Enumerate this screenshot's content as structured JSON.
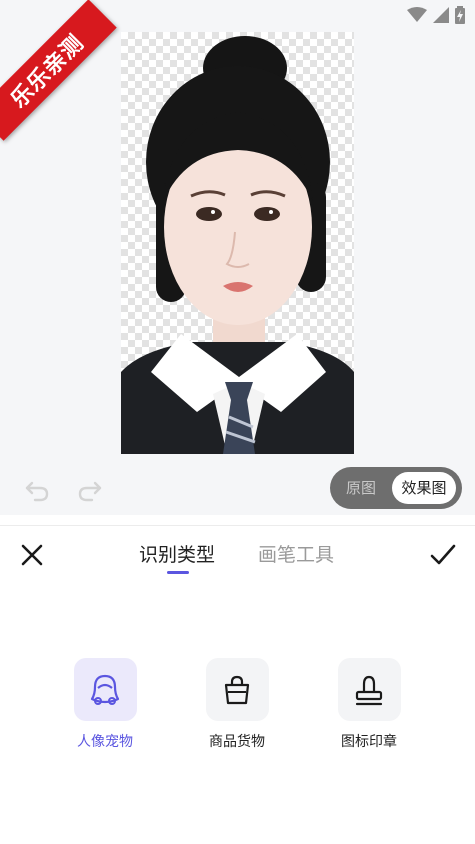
{
  "watermark": "乐乐亲测",
  "toggle": {
    "original": "原图",
    "effect": "效果图",
    "selected": "效果图"
  },
  "tabs": [
    {
      "label": "识别类型",
      "active": true
    },
    {
      "label": "画笔工具",
      "active": false
    }
  ],
  "options": [
    {
      "label": "人像宠物",
      "icon": "person-icon",
      "selected": true
    },
    {
      "label": "商品货物",
      "icon": "shopping-bag-icon",
      "selected": false
    },
    {
      "label": "图标印章",
      "icon": "stamp-icon",
      "selected": false
    }
  ],
  "colors": {
    "accent": "#5b56e0",
    "ribbon": "#d7191e",
    "toggle_bg": "#6e6e6e",
    "canvas_bg": "#f5f6f8"
  }
}
